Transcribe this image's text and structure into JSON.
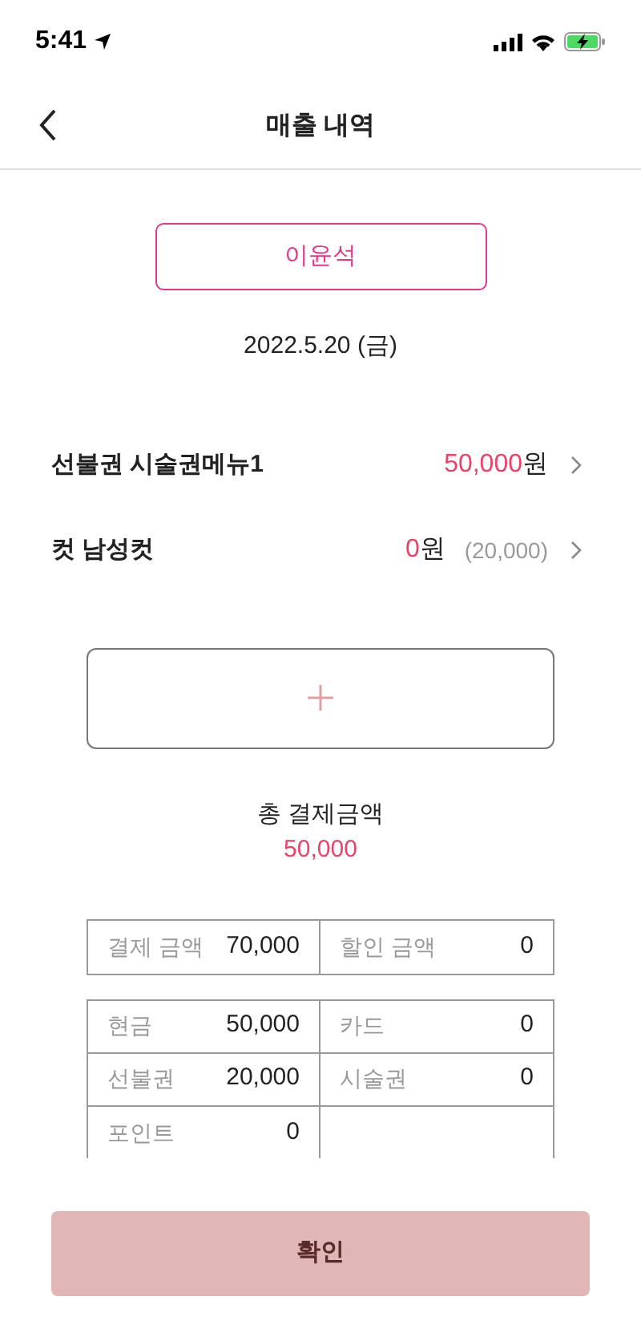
{
  "status_bar": {
    "time": "5:41"
  },
  "header": {
    "title": "매출 내역"
  },
  "customer_button": {
    "label": "이윤석"
  },
  "date": "2022.5.20 (금)",
  "items": [
    {
      "name": "선불권 시술권메뉴1",
      "amount": "50,000",
      "unit": "원"
    },
    {
      "name": "컷 남성컷",
      "amount": "0",
      "unit": "원",
      "original": "(20,000)"
    }
  ],
  "total": {
    "label": "총 결제금액",
    "amount": "50,000"
  },
  "summary": [
    {
      "label": "결제 금액",
      "value": "70,000"
    },
    {
      "label": "할인 금액",
      "value": "0"
    }
  ],
  "payments": [
    {
      "label": "현금",
      "value": "50,000"
    },
    {
      "label": "카드",
      "value": "0"
    },
    {
      "label": "선불권",
      "value": "20,000"
    },
    {
      "label": "시술권",
      "value": "0"
    },
    {
      "label": "포인트",
      "value": "0"
    }
  ],
  "confirm_button": {
    "label": "확인"
  }
}
